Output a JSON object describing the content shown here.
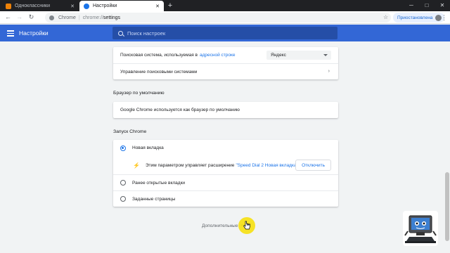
{
  "tabs": [
    {
      "label": "Одноклассники",
      "active": false
    },
    {
      "label": "Настройки",
      "active": true
    }
  ],
  "new_tab_symbol": "+",
  "window_controls": {
    "minimize": "─",
    "maximize": "□",
    "close": "✕"
  },
  "toolbar": {
    "back": "←",
    "forward": "→",
    "reload": "↻",
    "site_name": "Chrome",
    "separator": "|",
    "url_scheme": "chrome://",
    "url_path": "settings",
    "star": "☆",
    "profile_label": "Приостановлена",
    "menu": "⋮"
  },
  "header": {
    "title": "Настройки",
    "search_placeholder": "Поиск настроек"
  },
  "search_engine_card": {
    "engine_label": "Поисковая система, используемая в",
    "engine_link": "адресной строке",
    "engine_value": "Яндекс",
    "manage_label": "Управление поисковыми системами",
    "chevron": "›"
  },
  "default_browser": {
    "section_title": "Браузер по умолчанию",
    "status_text": "Google Chrome используется как браузер по умолчанию"
  },
  "startup": {
    "section_title": "Запуск Chrome",
    "options": [
      {
        "label": "Новая вкладка",
        "checked": true
      },
      {
        "label": "Ранее открытые вкладки",
        "checked": false
      },
      {
        "label": "Заданные страницы",
        "checked": false
      }
    ],
    "extension_notice": "Этим параметром управляет расширение",
    "extension_name": "\"Speed Dial 2 Новая вкладка\"",
    "disable_button": "Отключить"
  },
  "advanced": {
    "label": "Дополнительные",
    "arrow": "▾"
  },
  "colors": {
    "header_blue": "#3367d6",
    "accent": "#1a73e8",
    "cursor_highlight": "#f6e01a"
  }
}
